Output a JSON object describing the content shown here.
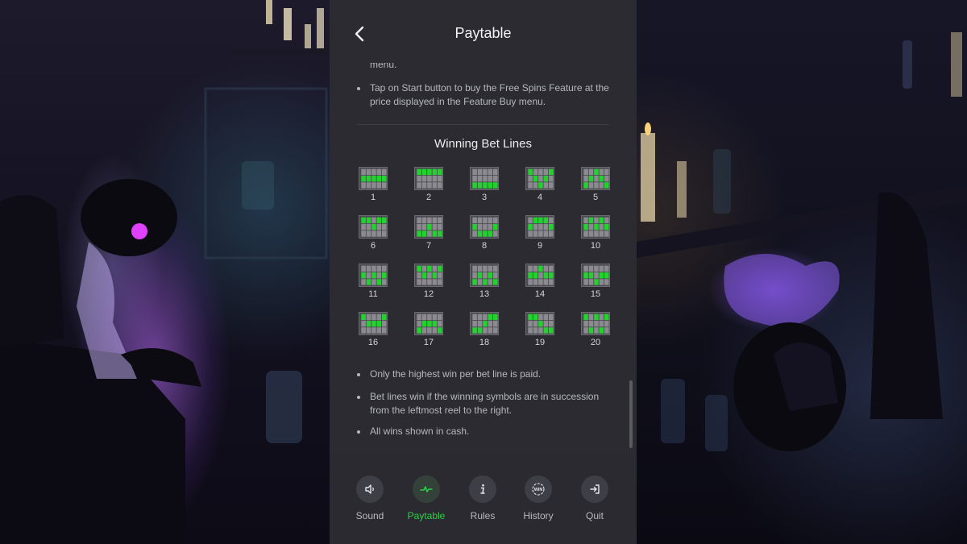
{
  "header": {
    "title": "Paytable",
    "back_icon": "chevron-left-icon"
  },
  "content": {
    "cut_text": "menu.",
    "intro_bullet": "Tap on Start button to buy the Free Spins Feature at the price displayed in the Feature Buy menu.",
    "section_title": "Winning Bet Lines",
    "bet_lines": [
      {
        "label": "1",
        "rows": [
          1,
          1,
          1,
          1,
          1
        ]
      },
      {
        "label": "2",
        "rows": [
          0,
          0,
          0,
          0,
          0
        ]
      },
      {
        "label": "3",
        "rows": [
          2,
          2,
          2,
          2,
          2
        ]
      },
      {
        "label": "4",
        "rows": [
          0,
          1,
          2,
          1,
          0
        ]
      },
      {
        "label": "5",
        "rows": [
          2,
          1,
          0,
          1,
          2
        ]
      },
      {
        "label": "6",
        "rows": [
          0,
          0,
          1,
          0,
          0
        ]
      },
      {
        "label": "7",
        "rows": [
          2,
          2,
          1,
          2,
          2
        ]
      },
      {
        "label": "8",
        "rows": [
          1,
          2,
          2,
          2,
          1
        ]
      },
      {
        "label": "9",
        "rows": [
          1,
          0,
          0,
          0,
          1
        ]
      },
      {
        "label": "10",
        "rows": [
          1,
          0,
          1,
          0,
          1
        ]
      },
      {
        "label": "11",
        "rows": [
          1,
          2,
          1,
          2,
          1
        ]
      },
      {
        "label": "12",
        "rows": [
          0,
          1,
          0,
          1,
          0
        ]
      },
      {
        "label": "13",
        "rows": [
          2,
          1,
          2,
          1,
          2
        ]
      },
      {
        "label": "14",
        "rows": [
          1,
          1,
          0,
          1,
          1
        ]
      },
      {
        "label": "15",
        "rows": [
          1,
          1,
          2,
          1,
          1
        ]
      },
      {
        "label": "16",
        "rows": [
          0,
          1,
          1,
          1,
          0
        ]
      },
      {
        "label": "17",
        "rows": [
          2,
          1,
          1,
          1,
          2
        ]
      },
      {
        "label": "18",
        "rows": [
          2,
          2,
          1,
          0,
          0
        ]
      },
      {
        "label": "19",
        "rows": [
          0,
          0,
          1,
          2,
          2
        ]
      },
      {
        "label": "20",
        "rows": [
          0,
          2,
          0,
          2,
          0
        ]
      }
    ],
    "rules": [
      "Only the highest win per bet line is paid.",
      "Bet lines win if the winning symbols are in succession from the leftmost reel to the right.",
      "All wins shown in cash."
    ]
  },
  "footer": {
    "items": [
      {
        "label": "Sound",
        "icon": "speaker-icon",
        "active": false
      },
      {
        "label": "Paytable",
        "icon": "pulse-icon",
        "active": true
      },
      {
        "label": "Rules",
        "icon": "info-icon",
        "active": false
      },
      {
        "label": "History",
        "icon": "win-badge-icon",
        "active": false
      },
      {
        "label": "Quit",
        "icon": "exit-icon",
        "active": false
      }
    ]
  },
  "colors": {
    "accent": "#27d045",
    "panel": "#2b2b31",
    "line_cell_on": "#23d12f",
    "line_cell_off": "#8a8a90"
  }
}
